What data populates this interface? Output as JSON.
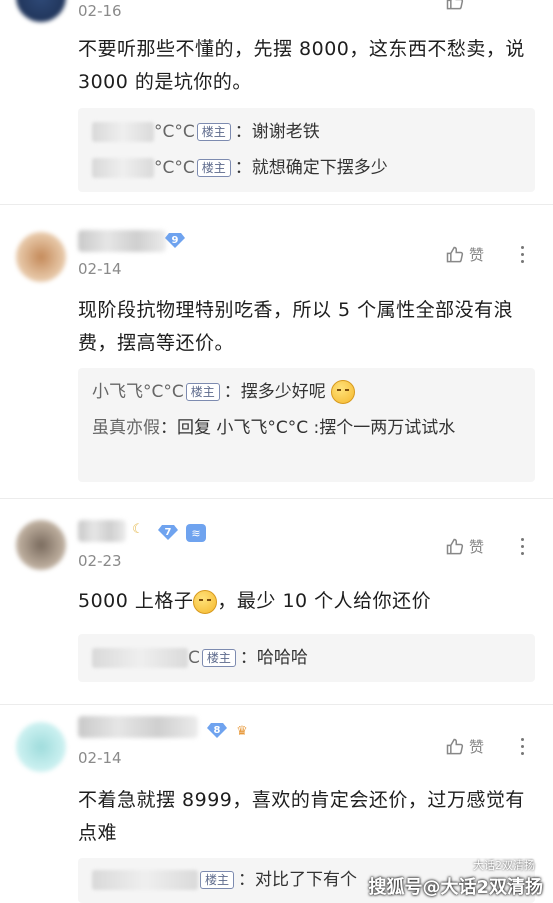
{
  "comments": [
    {
      "date": "02-16",
      "body": "不要听那些不懂的，先摆 8000，这东西不愁卖，说 3000 的是坑你的。",
      "replies": [
        {
          "name_suffix": "°C°C",
          "owner_tag": "楼主",
          "text": "：谢谢老铁"
        },
        {
          "name_suffix": "°C°C",
          "owner_tag": "楼主",
          "text": "：就想确定下摆多少"
        }
      ]
    },
    {
      "date": "02-14",
      "level": "9",
      "like_label": "赞",
      "body": "现阶段抗物理特别吃香，所以 5 个属性全部没有浪费，摆高等还价。",
      "replies": [
        {
          "name": "小飞飞°C°C",
          "owner_tag": "楼主",
          "text": "：摆多少好呢"
        },
        {
          "name": "虽真亦假",
          "text": "：回复 小飞飞°C°C :摆个一两万试试水"
        }
      ]
    },
    {
      "date": "02-23",
      "level": "7",
      "like_label": "赞",
      "body": "5000 上格子",
      "body_tail": "，最少 10 个人给你还价",
      "replies": [
        {
          "name_suffix": "C",
          "owner_tag": "楼主",
          "text": "：哈哈哈"
        }
      ]
    },
    {
      "date": "02-14",
      "level": "8",
      "like_label": "赞",
      "body": "不着急就摆 8999，喜欢的肯定会还价，过万感觉有点难",
      "replies": [
        {
          "owner_tag": "楼主",
          "text": "：对比了下有个"
        }
      ]
    }
  ],
  "watermark": {
    "main": "搜狐号@大话2双清扬",
    "small": "大话2双清扬"
  },
  "colors": {
    "level_badge": "#6fa3ef",
    "date": "#8a8a8a",
    "reply_bg": "#f5f5f5"
  }
}
